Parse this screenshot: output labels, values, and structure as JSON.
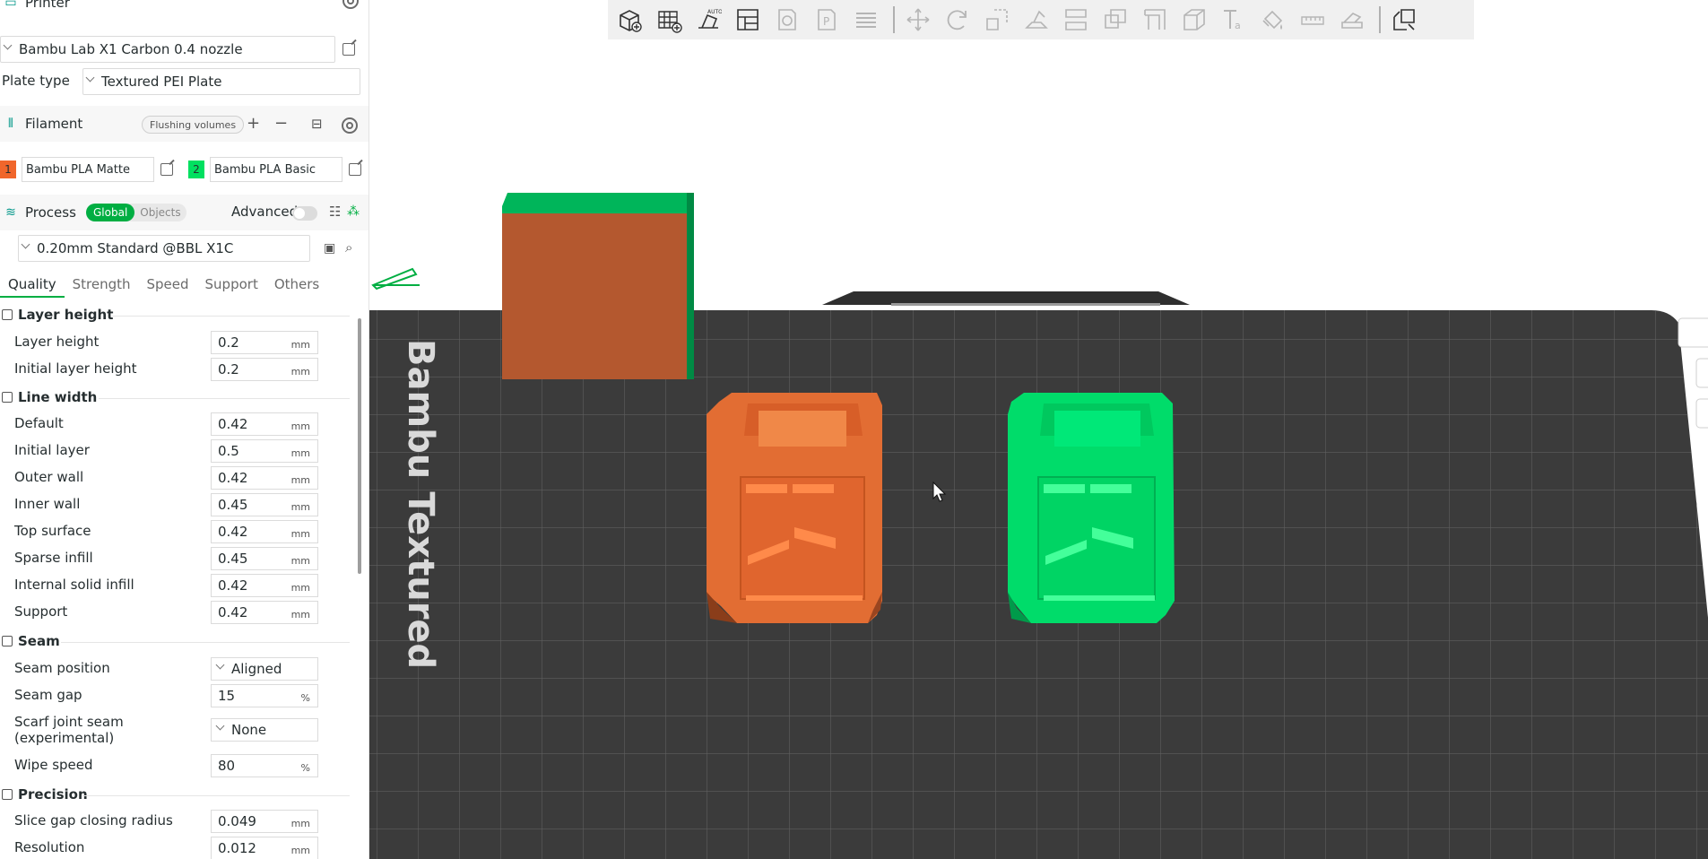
{
  "printer": {
    "title": "Printer",
    "model": "Bambu Lab X1 Carbon 0.4 nozzle",
    "plate_label": "Plate type",
    "plate_value": "Textured PEI Plate"
  },
  "filament": {
    "title": "Filament",
    "flushing_label": "Flushing volumes",
    "items": [
      {
        "num": "1",
        "name": "Bambu PLA Matte",
        "color": "#f0662b"
      },
      {
        "num": "2",
        "name": "Bambu PLA Basic",
        "color": "#00e060"
      }
    ]
  },
  "process": {
    "title": "Process",
    "global_label": "Global",
    "objects_label": "Objects",
    "advanced_label": "Advanced",
    "preset": "0.20mm Standard @BBL X1C",
    "tabs": [
      "Quality",
      "Strength",
      "Speed",
      "Support",
      "Others"
    ]
  },
  "groups": {
    "layer_height": "Layer height",
    "line_width": "Line width",
    "seam": "Seam",
    "precision": "Precision"
  },
  "options": {
    "layer_height": {
      "label": "Layer height",
      "value": "0.2",
      "unit": "mm"
    },
    "initial_layer_height": {
      "label": "Initial layer height",
      "value": "0.2",
      "unit": "mm"
    },
    "lw_default": {
      "label": "Default",
      "value": "0.42",
      "unit": "mm"
    },
    "lw_initial": {
      "label": "Initial layer",
      "value": "0.5",
      "unit": "mm"
    },
    "lw_outer": {
      "label": "Outer wall",
      "value": "0.42",
      "unit": "mm"
    },
    "lw_inner": {
      "label": "Inner wall",
      "value": "0.45",
      "unit": "mm"
    },
    "lw_top": {
      "label": "Top surface",
      "value": "0.42",
      "unit": "mm"
    },
    "lw_sparse": {
      "label": "Sparse infill",
      "value": "0.45",
      "unit": "mm"
    },
    "lw_internal": {
      "label": "Internal solid infill",
      "value": "0.42",
      "unit": "mm"
    },
    "lw_support": {
      "label": "Support",
      "value": "0.42",
      "unit": "mm"
    },
    "seam_position": {
      "label": "Seam position",
      "value": "Aligned"
    },
    "seam_gap": {
      "label": "Seam gap",
      "value": "15",
      "unit": "%"
    },
    "scarf_joint_1": "Scarf joint seam",
    "scarf_joint_2": "(experimental)",
    "scarf_joint_value": "None",
    "wipe_speed": {
      "label": "Wipe speed",
      "value": "80",
      "unit": "%"
    },
    "slice_gap": {
      "label": "Slice gap closing radius",
      "value": "0.049",
      "unit": "mm"
    },
    "resolution": {
      "label": "Resolution",
      "value": "0.012",
      "unit": "mm"
    }
  },
  "viewport": {
    "plate_text": "Bambu Textured",
    "colors": {
      "orange": "#e26d33",
      "green": "#00dc6a",
      "bed": "#3b3b3b"
    }
  }
}
